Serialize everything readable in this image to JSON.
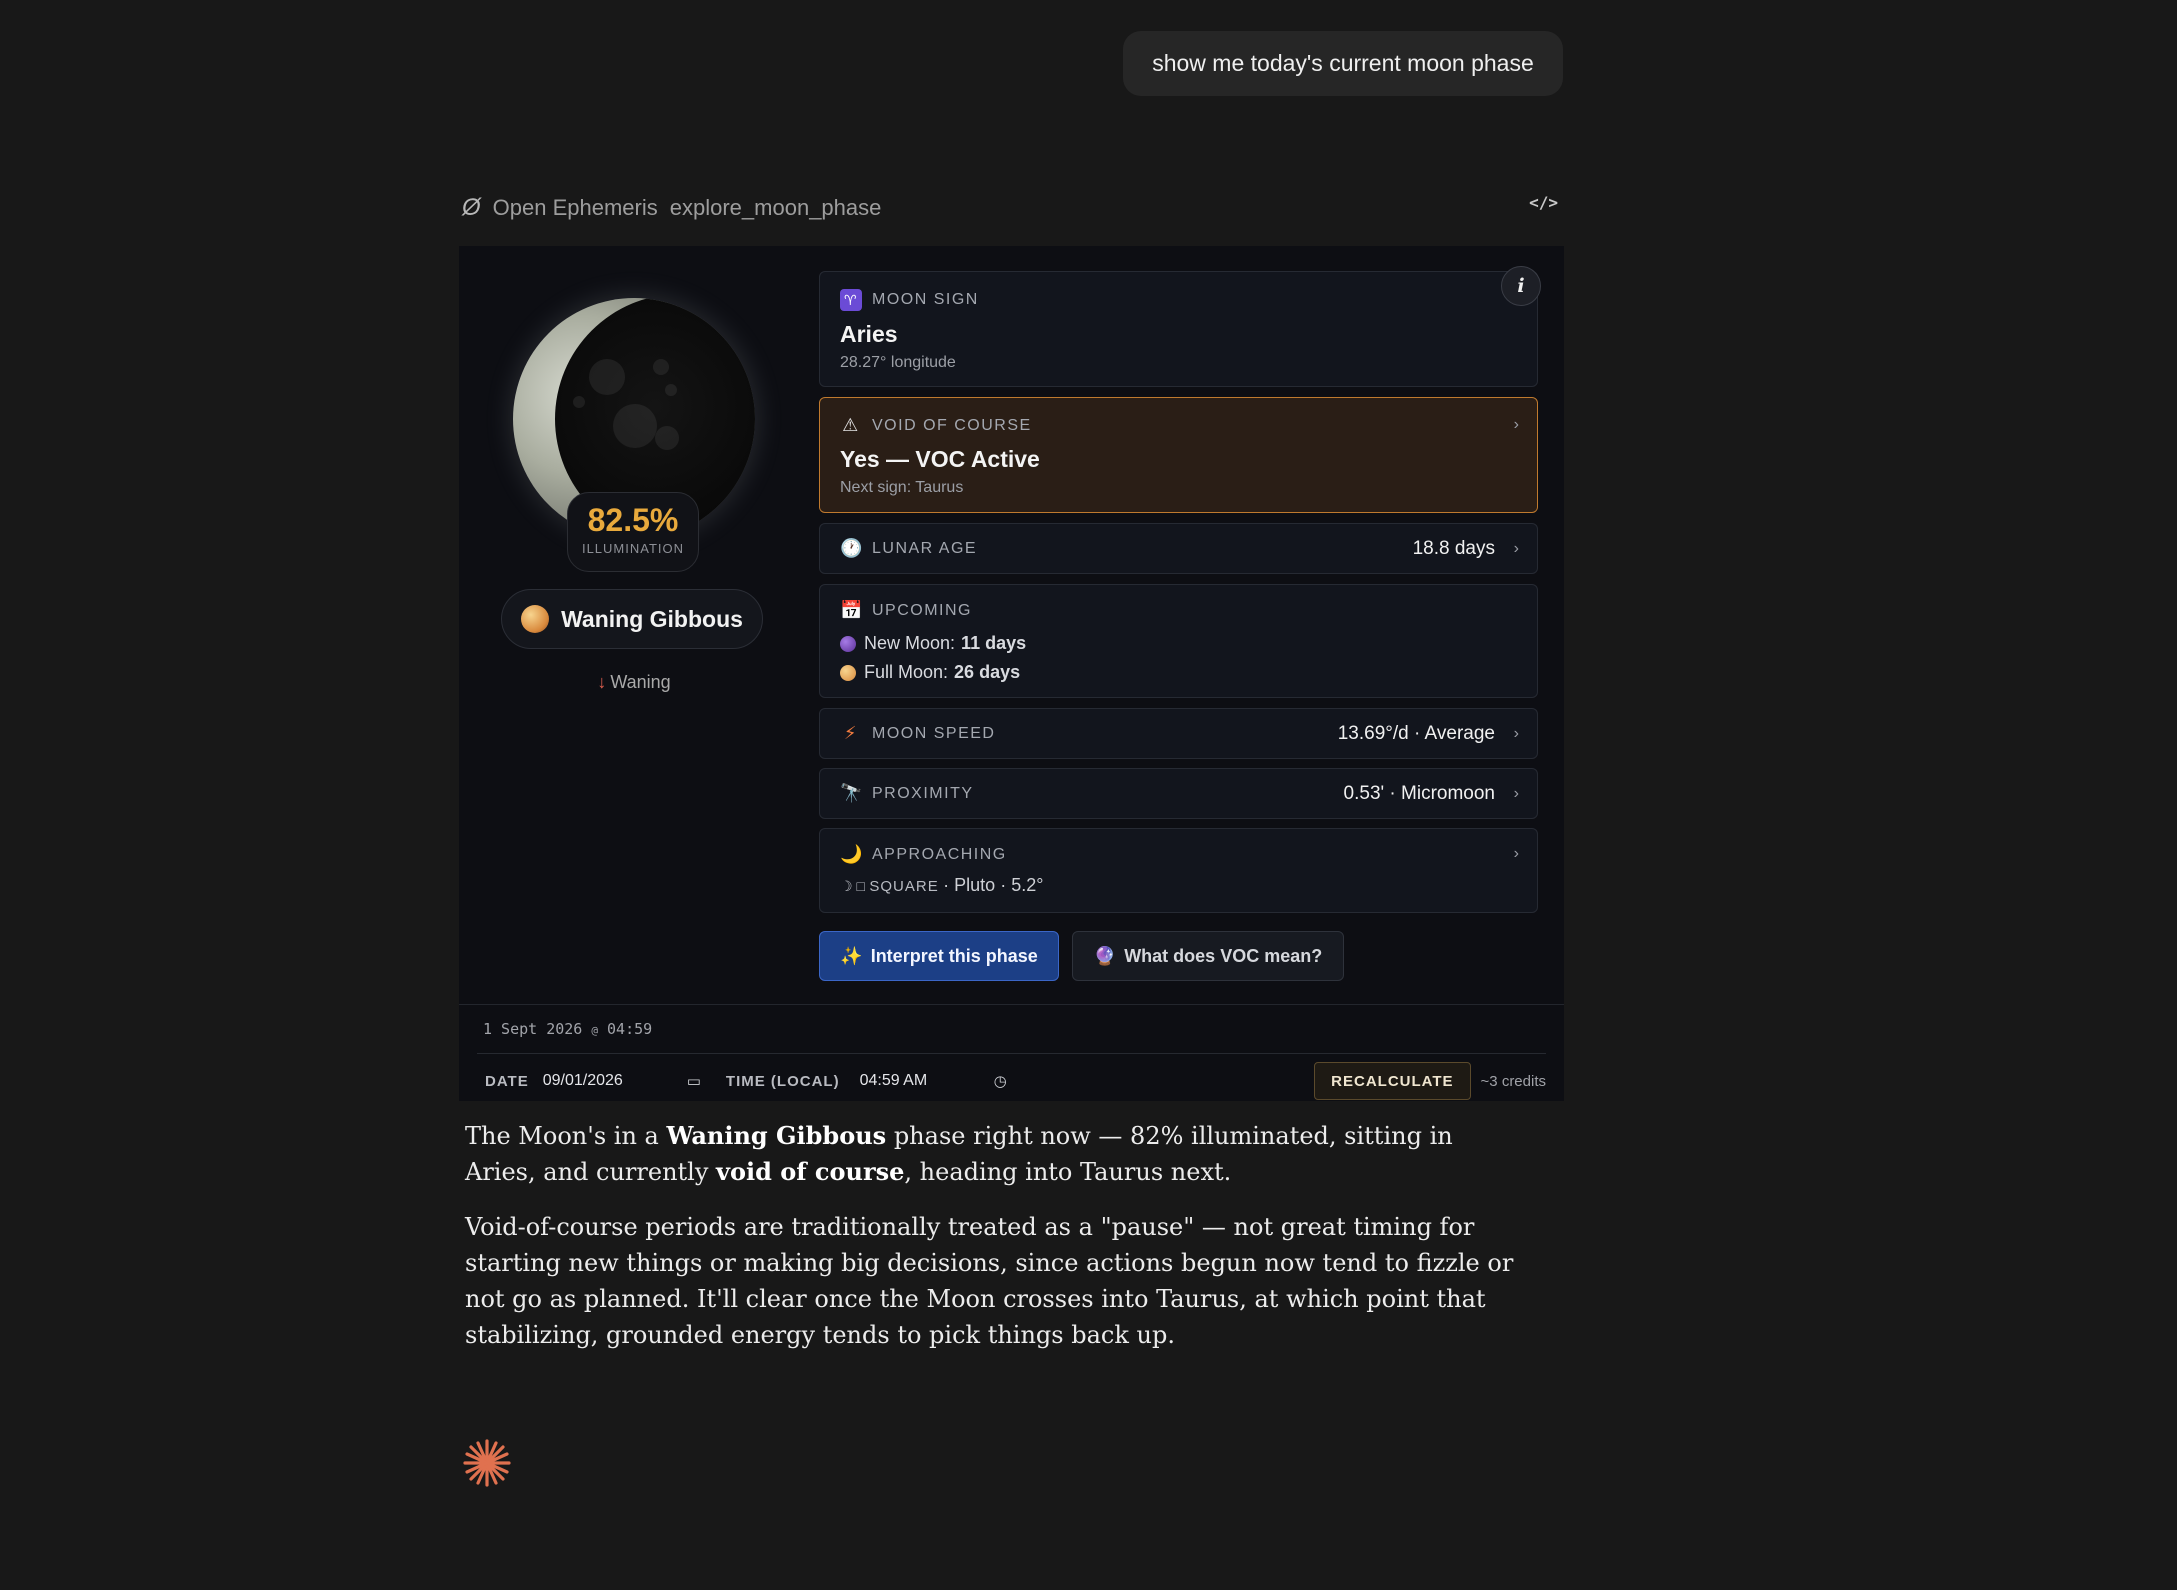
{
  "user_message": "show me today's current moon phase",
  "tool": {
    "logo_icon": "open-ephemeris-logo",
    "name": "Open Ephemeris",
    "function": "explore_moon_phase"
  },
  "moon": {
    "illumination": "82.5%",
    "illumination_fraction": 0.825,
    "illumination_label": "ILLUMINATION",
    "phase": "Waning Gibbous",
    "trend_arrow": "↓",
    "trend": "Waning"
  },
  "cards": {
    "moon_sign": {
      "icon": "♈",
      "label": "MOON SIGN",
      "value": "Aries",
      "sub": "28.27° longitude"
    },
    "voc": {
      "icon": "⚠",
      "label": "VOID OF COURSE",
      "value": "Yes — VOC Active",
      "sub": "Next sign: Taurus"
    },
    "lunar_age": {
      "icon": "🕐",
      "label": "LUNAR AGE",
      "value": "18.8 days"
    },
    "upcoming": {
      "icon": "📅",
      "label": "UPCOMING",
      "new_moon_label": "New Moon:",
      "new_moon_value": "11 days",
      "full_moon_label": "Full Moon:",
      "full_moon_value": "26 days"
    },
    "moon_speed": {
      "icon": "⚡",
      "label": "MOON SPEED",
      "value": "13.69°/d · Average"
    },
    "proximity": {
      "icon": "🔭",
      "label": "PROXIMITY",
      "value": "0.53' · Micromoon"
    },
    "approaching": {
      "icon": "🌙",
      "label": "APPROACHING",
      "aspect_symbol": "☽ □",
      "aspect": "SQUARE",
      "target": "· Pluto · 5.2°"
    }
  },
  "buttons": {
    "interpret": "Interpret this phase",
    "interpret_icon": "✨",
    "voc_help": "What does VOC mean?",
    "voc_help_icon": "🔮"
  },
  "footer": {
    "stamp_date": "1 Sept 2026",
    "stamp_at": "@",
    "stamp_time": "04:59",
    "date_label": "DATE",
    "date_value": "09/01/2026",
    "time_label": "TIME (LOCAL)",
    "time_value": "04:59 AM",
    "recalculate": "RECALCULATE",
    "credits": "~3 credits"
  },
  "response": {
    "p1_a": "The Moon's in a ",
    "p1_b": "Waning Gibbous",
    "p1_c": " phase right now — 82% illuminated, sitting in Aries, and currently ",
    "p1_d": "void of course",
    "p1_e": ", heading into Taurus next.",
    "p2": "Void-of-course periods are traditionally treated as a \"pause\" — not great timing for starting new things or making big decisions, since actions begun now tend to fizzle or not go as planned. It'll clear once the Moon crosses into Taurus, at which point that stabilizing, grounded energy tends to pick things back up."
  },
  "colors": {
    "background": "#181818",
    "widget_bg": "#0d0e13",
    "accent_gold": "#e8a93c",
    "voc_border": "#c07a2e",
    "primary_button": "#1c3f86",
    "loader": "#e0714f"
  }
}
